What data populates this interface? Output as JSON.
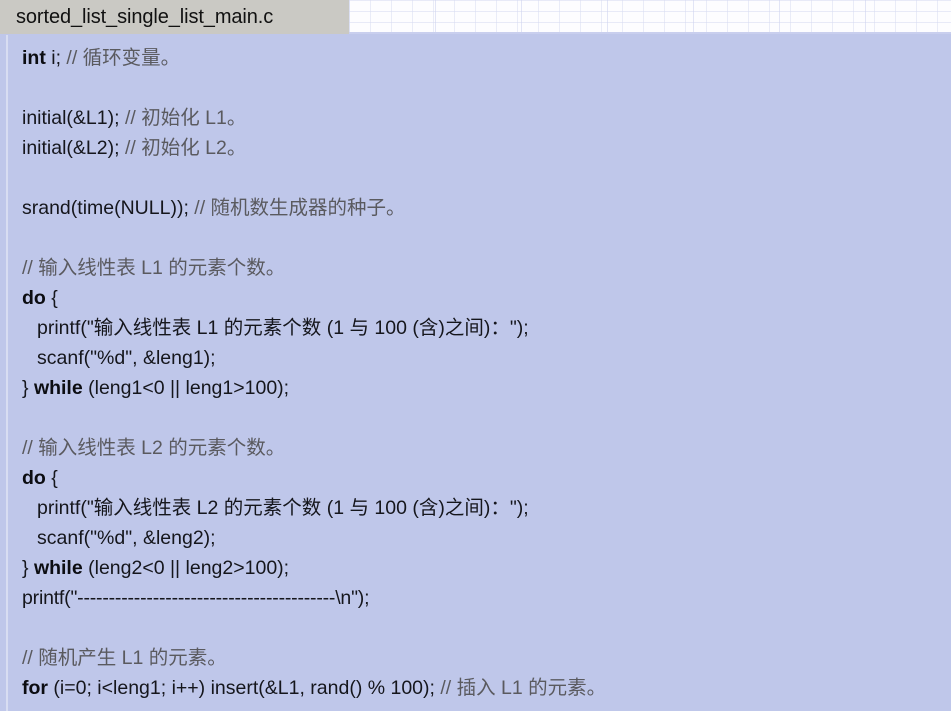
{
  "window": {
    "tab_title": "sorted_list_single_list_main.c",
    "background_color": "#bfc7ea",
    "tab_bar_color": "#cac9c4",
    "code_color": "#15161c",
    "comment_color": "#5a5a5f"
  },
  "grid": {
    "name": "faint-spreadsheet-grid"
  },
  "code": {
    "lines": [
      {
        "id": "l1",
        "indent": 0,
        "segments": [
          {
            "t": "int ",
            "s": "kw"
          },
          {
            "t": "i; ",
            "s": ""
          },
          {
            "t": "// 循环变量。",
            "s": "cm"
          }
        ]
      },
      {
        "id": "l2",
        "indent": 0,
        "segments": []
      },
      {
        "id": "l3",
        "indent": 0,
        "segments": [
          {
            "t": "initial(&L1); ",
            "s": ""
          },
          {
            "t": "// 初始化 L1。",
            "s": "cm"
          }
        ]
      },
      {
        "id": "l4",
        "indent": 0,
        "segments": [
          {
            "t": "initial(&L2); ",
            "s": ""
          },
          {
            "t": "// 初始化 L2。",
            "s": "cm"
          }
        ]
      },
      {
        "id": "l5",
        "indent": 0,
        "segments": []
      },
      {
        "id": "l6",
        "indent": 0,
        "segments": [
          {
            "t": "srand(time(NULL)); ",
            "s": ""
          },
          {
            "t": "// 随机数生成器的种子。",
            "s": "cm"
          }
        ]
      },
      {
        "id": "l7",
        "indent": 0,
        "segments": []
      },
      {
        "id": "l8",
        "indent": 0,
        "segments": [
          {
            "t": "// 输入线性表 L1 的元素个数。",
            "s": "cm"
          }
        ]
      },
      {
        "id": "l9",
        "indent": 0,
        "segments": [
          {
            "t": "do",
            "s": "kw"
          },
          {
            "t": " {",
            "s": ""
          }
        ]
      },
      {
        "id": "l10",
        "indent": 1,
        "segments": [
          {
            "t": "printf(\"输入线性表 L1 的元素个数 (1 与 100 (含)之间)：\");",
            "s": ""
          }
        ]
      },
      {
        "id": "l11",
        "indent": 1,
        "segments": [
          {
            "t": "scanf(\"%d\", &leng1);",
            "s": ""
          }
        ]
      },
      {
        "id": "l12",
        "indent": 0,
        "segments": [
          {
            "t": "} ",
            "s": ""
          },
          {
            "t": "while",
            "s": "kw"
          },
          {
            "t": " (leng1<0 || leng1>100);",
            "s": ""
          }
        ]
      },
      {
        "id": "l13",
        "indent": 0,
        "segments": []
      },
      {
        "id": "l14",
        "indent": 0,
        "segments": [
          {
            "t": "// 输入线性表 L2 的元素个数。",
            "s": "cm"
          }
        ]
      },
      {
        "id": "l15",
        "indent": 0,
        "segments": [
          {
            "t": "do",
            "s": "kw"
          },
          {
            "t": " {",
            "s": ""
          }
        ]
      },
      {
        "id": "l16",
        "indent": 1,
        "segments": [
          {
            "t": "printf(\"输入线性表 L2 的元素个数 (1 与 100 (含)之间)：\");",
            "s": ""
          }
        ]
      },
      {
        "id": "l17",
        "indent": 1,
        "segments": [
          {
            "t": "scanf(\"%d\", &leng2);",
            "s": ""
          }
        ]
      },
      {
        "id": "l18",
        "indent": 0,
        "segments": [
          {
            "t": "} ",
            "s": ""
          },
          {
            "t": "while",
            "s": "kw"
          },
          {
            "t": " (leng2<0 || leng2>100);",
            "s": ""
          }
        ]
      },
      {
        "id": "l19",
        "indent": 0,
        "segments": [
          {
            "t": "printf(\"-----------------------------------------\\n\");",
            "s": "dash"
          }
        ]
      },
      {
        "id": "l20",
        "indent": 0,
        "segments": []
      },
      {
        "id": "l21",
        "indent": 0,
        "segments": [
          {
            "t": "// 随机产生 L1 的元素。",
            "s": "cm"
          }
        ]
      },
      {
        "id": "l22",
        "indent": 0,
        "segments": [
          {
            "t": "for",
            "s": "kw"
          },
          {
            "t": " (i=0; i<leng1; i++) insert(&L1, rand() % 100); ",
            "s": ""
          },
          {
            "t": "// 插入 L1 的元素。",
            "s": "cm"
          }
        ]
      }
    ]
  }
}
